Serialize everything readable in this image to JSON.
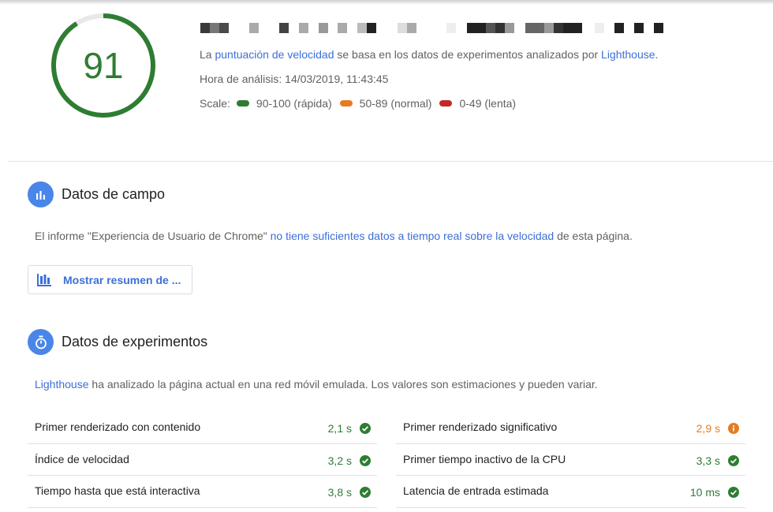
{
  "score": {
    "value": "91",
    "fraction": 0.91,
    "color": "#2e7d32",
    "track_color": "#e8e8e8"
  },
  "header": {
    "summary_prefix": "La ",
    "summary_link1": "puntuación de velocidad",
    "summary_middle": " se basa en los datos de experimentos analizados por ",
    "summary_link2": "Lighthouse",
    "summary_suffix": ".",
    "analysis_time": "Hora de análisis: 14/03/2019, 11:43:45",
    "scale_label": "Scale:",
    "scale": [
      {
        "label": "90-100 (rápida)",
        "color": "#2e7d32"
      },
      {
        "label": "50-89 (normal)",
        "color": "#e67c22"
      },
      {
        "label": "0-49 (lenta)",
        "color": "#c62828"
      }
    ]
  },
  "field_data": {
    "title": "Datos de campo",
    "text_prefix": "El informe \"Experiencia de Usuario de Chrome\" ",
    "text_link": "no tiene suficientes datos a tiempo real sobre la velocidad",
    "text_suffix": " de esta página.",
    "button_label": "Mostrar resumen de ...",
    "icon": "bar-chart-icon"
  },
  "lab_data": {
    "title": "Datos de experimentos",
    "text_link": "Lighthouse",
    "text_rest": " ha analizado la página actual en una red móvil emulada. Los valores son estimaciones y pueden variar.",
    "icon": "timer-icon",
    "metrics_left": [
      {
        "name": "Primer renderizado con contenido",
        "value": "2,1 s",
        "status": "pass"
      },
      {
        "name": "Índice de velocidad",
        "value": "3,2 s",
        "status": "pass"
      },
      {
        "name": "Tiempo hasta que está interactiva",
        "value": "3,8 s",
        "status": "pass"
      }
    ],
    "metrics_right": [
      {
        "name": "Primer renderizado significativo",
        "value": "2,9 s",
        "status": "average"
      },
      {
        "name": "Primer tiempo inactivo de la CPU",
        "value": "3,3 s",
        "status": "pass"
      },
      {
        "name": "Latencia de entrada estimada",
        "value": "10 ms",
        "status": "pass"
      }
    ]
  },
  "colors": {
    "pass": "#2e7d32",
    "average": "#e67c22",
    "link": "#3c6fd8",
    "accent": "#4a86e8"
  }
}
